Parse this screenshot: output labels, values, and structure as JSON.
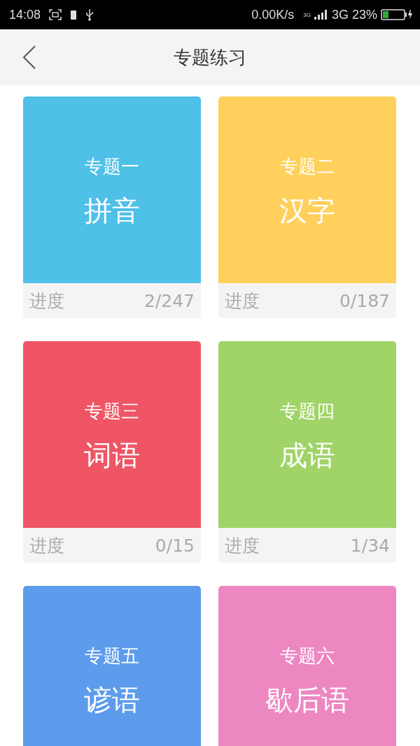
{
  "status_bar": {
    "time": "14:08",
    "speed": "0.00K/s",
    "network_small": "3G",
    "network": "3G",
    "battery": "23%"
  },
  "header": {
    "title": "专题练习"
  },
  "cards": [
    {
      "topic": "专题一",
      "name": "拼音",
      "color": "#4fc0e8",
      "progress_label": "进度",
      "progress": "2/247"
    },
    {
      "topic": "专题二",
      "name": "汉字",
      "color": "#ffd05c",
      "progress_label": "进度",
      "progress": "0/187"
    },
    {
      "topic": "专题三",
      "name": "词语",
      "color": "#ef5565",
      "progress_label": "进度",
      "progress": "0/15"
    },
    {
      "topic": "专题四",
      "name": "成语",
      "color": "#a0d468",
      "progress_label": "进度",
      "progress": "1/34"
    },
    {
      "topic": "专题五",
      "name": "谚语",
      "color": "#5d9cec"
    },
    {
      "topic": "专题六",
      "name": "歇后语",
      "color": "#ed87c2"
    }
  ]
}
